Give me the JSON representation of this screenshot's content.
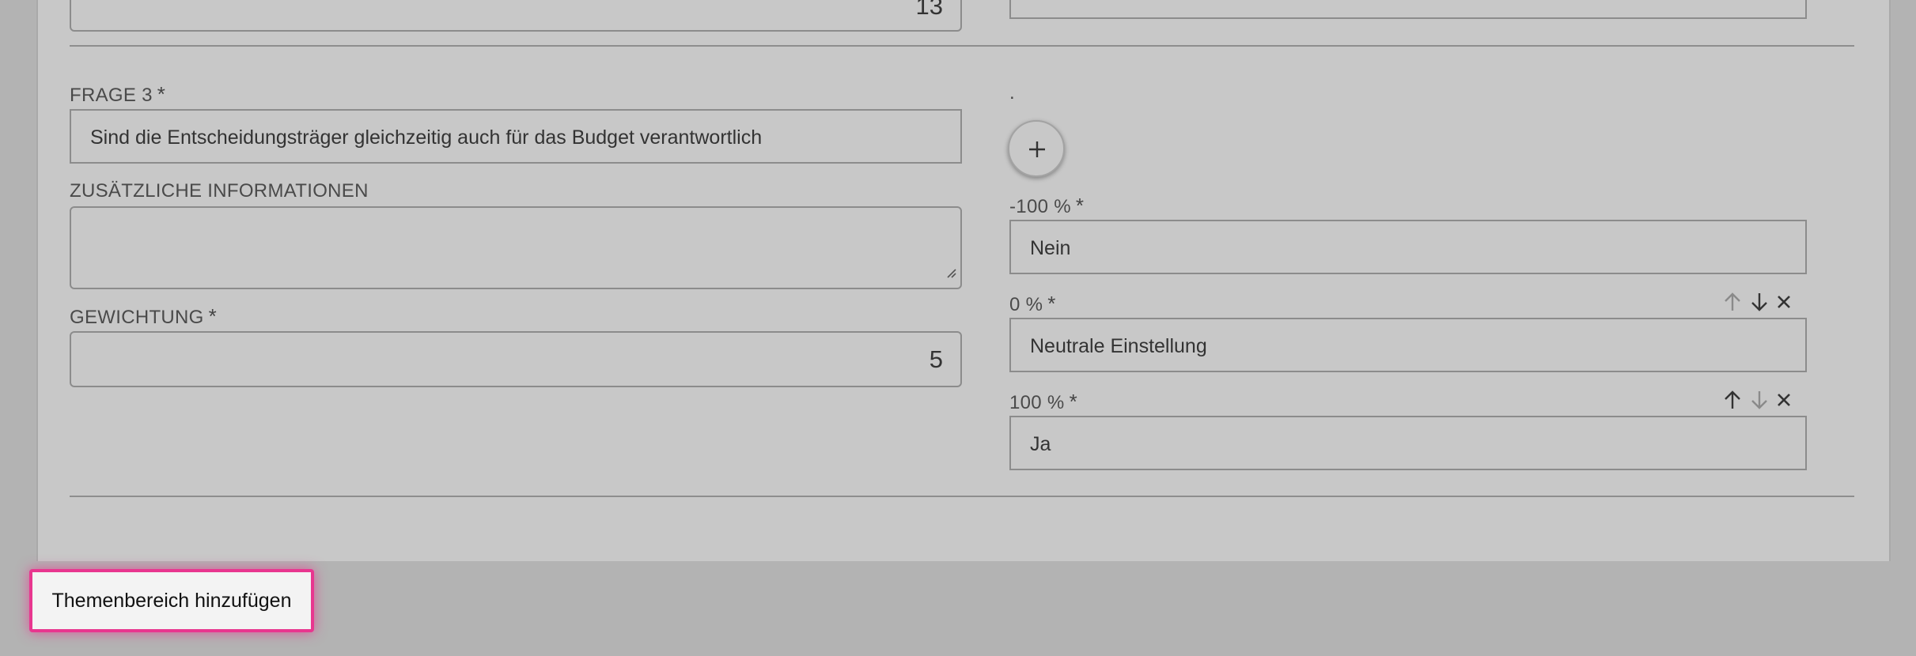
{
  "previous_question": {
    "weight_value": "13"
  },
  "question3": {
    "label": "FRAGE 3",
    "required_marker": "*",
    "question_text": "Sind die Entscheidungsträger gleichzeitig auch für das Budget verantwortlich",
    "additional_info_label": "ZUSÄTZLICHE INFORMATIONEN",
    "additional_info_value": "",
    "weight_label": "GEWICHTUNG",
    "weight_value": "5"
  },
  "answers": {
    "header_dot": ".",
    "add_icon": "plus-icon",
    "items": [
      {
        "percent_label": "-100 %",
        "text": "Nein"
      },
      {
        "percent_label": "0 %",
        "text": "Neutrale Einstellung"
      },
      {
        "percent_label": "100 %",
        "text": "Ja"
      }
    ]
  },
  "footer": {
    "add_topic_label": "Themenbereich hinzufügen"
  },
  "colors": {
    "panel_bg": "#c8c8c8",
    "page_bg": "#b3b3b3",
    "highlight": "#e8368f"
  }
}
